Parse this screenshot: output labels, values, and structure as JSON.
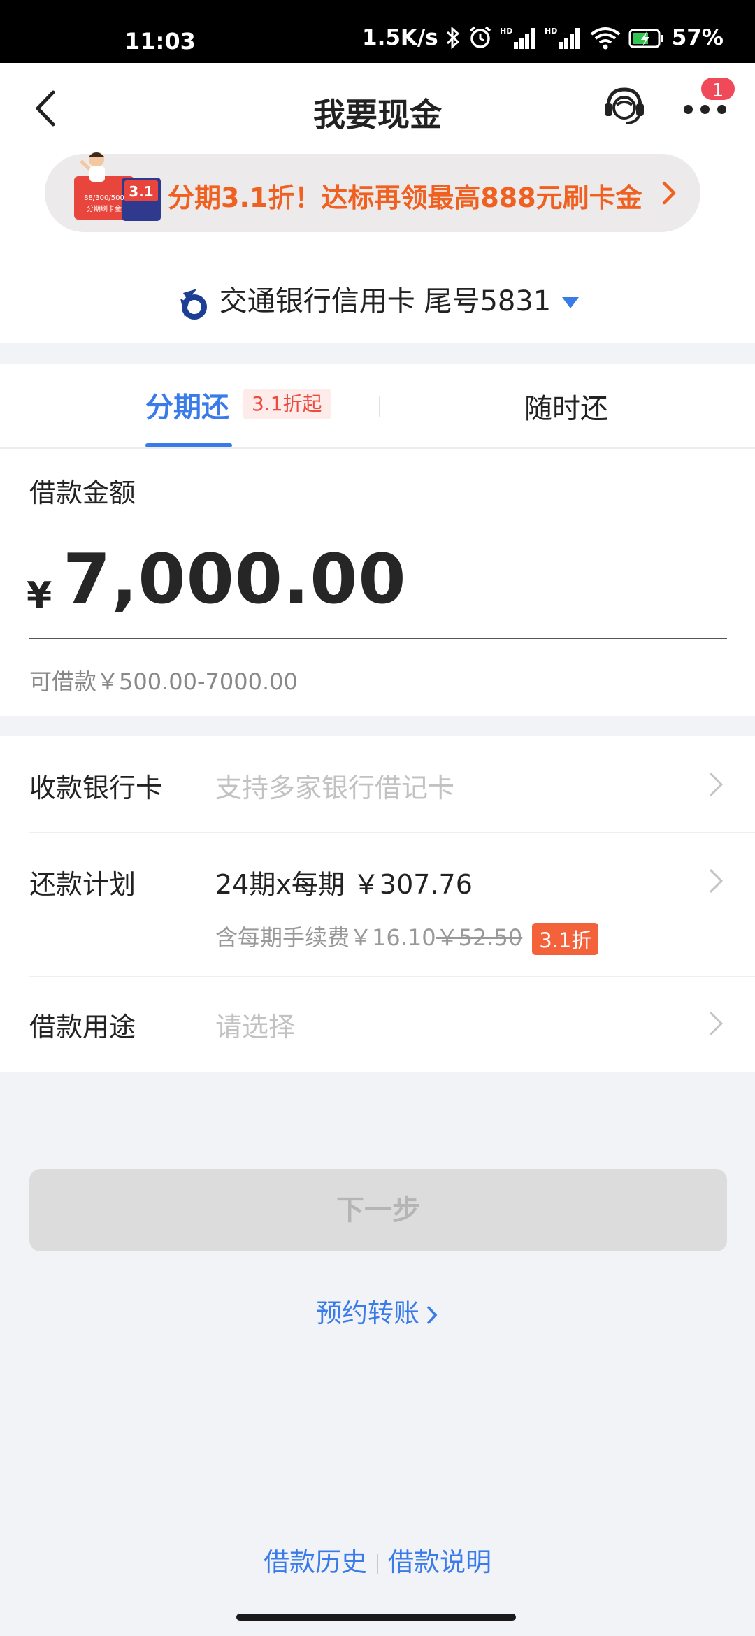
{
  "status_bar": {
    "time": "11:03",
    "speed": "1.5K/s",
    "battery": "57%"
  },
  "header": {
    "title": "我要现金",
    "notification_count": "1"
  },
  "promo": {
    "text": "分期3.1折！达标再领最高888元刷卡金",
    "image_text_top": "88/300/500",
    "image_text_bottom": "分期刷卡金",
    "image_badge": "3.1"
  },
  "card_selector": {
    "label": "交通银行信用卡 尾号5831"
  },
  "tabs": {
    "installment": "分期还",
    "installment_tag": "3.1折起",
    "anytime": "随时还"
  },
  "amount": {
    "label": "借款金额",
    "currency": "¥",
    "value": "7,000.00",
    "range": "可借款￥500.00-7000.00"
  },
  "form": {
    "receiving_card_label": "收款银行卡",
    "receiving_card_placeholder": "支持多家银行借记卡",
    "plan_label": "还款计划",
    "plan_value": "24期x每期 ￥307.76",
    "fee_prefix": "含每期手续费￥16.10",
    "fee_original": "￥52.50",
    "fee_tag": "3.1折",
    "purpose_label": "借款用途",
    "purpose_placeholder": "请选择"
  },
  "actions": {
    "next": "下一步",
    "reserve_transfer": "预约转账"
  },
  "footer": {
    "history": "借款历史",
    "explanation": "借款说明"
  },
  "colors": {
    "accent": "#3a7bea",
    "promo": "#f06020",
    "tag": "#f3623a"
  }
}
